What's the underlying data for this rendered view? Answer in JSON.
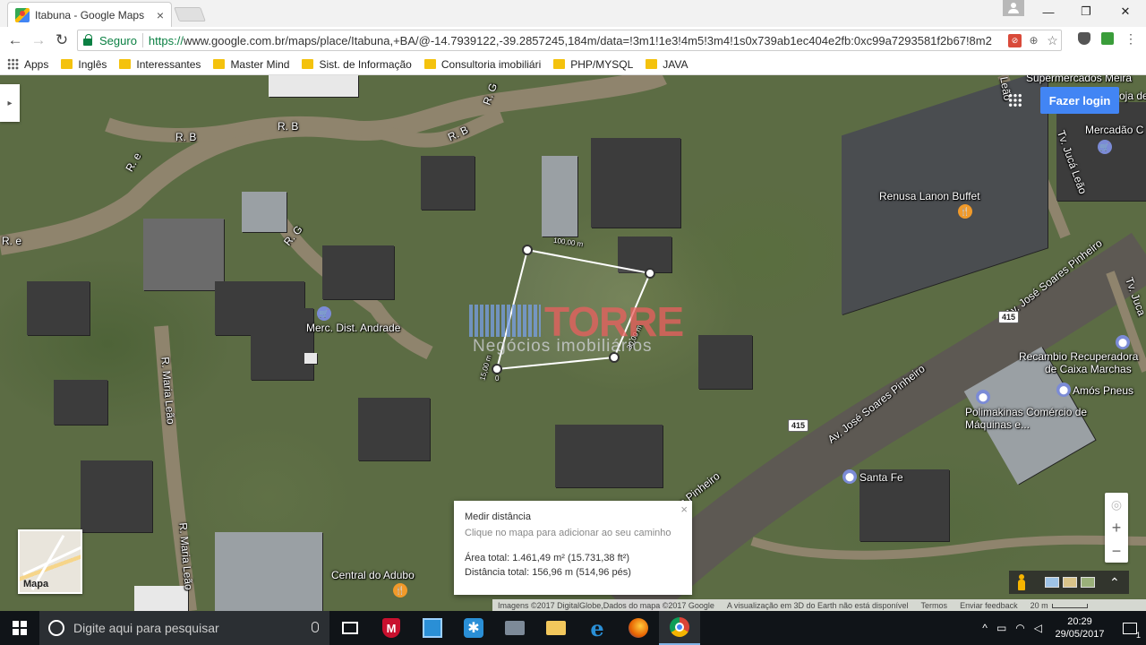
{
  "browser": {
    "tab_title": "Itabuna - Google Maps",
    "tab_close": "×",
    "window_minimize": "—",
    "window_maximize": "❐",
    "window_close": "✕",
    "secure_label": "Seguro",
    "url_protocol": "https://",
    "url_rest": "www.google.com.br/maps/place/Itabuna,+BA/@-14.7939122,-39.2857245,184m/data=!3m1!1e3!4m5!3m4!1s0x739ab1ec404e2fb:0xc99a7293581f2b67!8m2"
  },
  "bookmarks": [
    {
      "label": "Apps",
      "icon": "apps-grid-icon"
    },
    {
      "label": "Inglês",
      "icon": "folder-icon"
    },
    {
      "label": "Interessantes",
      "icon": "folder-icon"
    },
    {
      "label": "Master Mind",
      "icon": "folder-icon"
    },
    {
      "label": "Sist. de Informação",
      "icon": "folder-icon"
    },
    {
      "label": "Consultoria imobiliári",
      "icon": "folder-icon"
    },
    {
      "label": "PHP/MYSQL",
      "icon": "folder-icon"
    },
    {
      "label": "JAVA",
      "icon": "folder-icon"
    }
  ],
  "map": {
    "login_button": "Fazer login",
    "labels": {
      "supermercados": "Supermercados Meira",
      "loja": "oja de",
      "mercadao": "Mercadão C",
      "renusa": "Renusa Lanon Buffet",
      "merc_dist": "Merc. Dist. Andrade",
      "recambio": "Recambio Recuperadora",
      "caixa": "de Caixa Marchas",
      "amos": "Amós Pneus",
      "polimakinas1": "Polimakinas Comércio de",
      "polimakinas2": "Máquinas e...",
      "santa_fe": "Santa Fe",
      "central_adubo": "Central do Adubo"
    },
    "roads": {
      "rb1": "R. B",
      "rb2": "R. B",
      "rb3": "R. B",
      "rg1": "R. G",
      "rg2": "R. G",
      "re1": "R. e",
      "re2": "R. e",
      "maria_leao1": "R. Maria Leão",
      "maria_leao2": "R. Maria Leão",
      "av_jsp1": "Av. José Soares Pinheiro",
      "av_jsp2": "Av. José Soares Pinheiro",
      "av_jsp3": "Soares Pinheiro",
      "tv_juca1": "Tv. Jucá Leão",
      "tv_juca2": "Tv. Juca",
      "leao_top": "Leão",
      "shield_415": "415"
    },
    "measure": {
      "top_label": "100,00 m",
      "right_label": "30,00 m",
      "left_label": "15,00 m",
      "zero_label": "0"
    },
    "watermark": {
      "brand": "TORRE",
      "sub": "Negócios imobiliários"
    },
    "popup": {
      "title": "Medir distância",
      "hint": "Clique no mapa para adicionar ao seu caminho",
      "area": "Área total: 1.461,49 m² (15.731,38 ft²)",
      "distance": "Distância total: 156,96 m (514,96 pés)",
      "close": "×"
    },
    "minimap_label": "Mapa",
    "zoom_in": "+",
    "zoom_out": "−",
    "compass": "◎",
    "expand": "⌃",
    "footer": {
      "imagery": "Imagens ©2017 DigitalGlobe,Dados do mapa ©2017 Google",
      "no3d": "A visualização em 3D do Earth não está disponível",
      "terms": "Termos",
      "feedback": "Enviar feedback",
      "scale": "20 m"
    }
  },
  "taskbar": {
    "search_placeholder": "Digite aqui para pesquisar",
    "time": "20:29",
    "date": "29/05/2017",
    "notification_count": "1"
  }
}
